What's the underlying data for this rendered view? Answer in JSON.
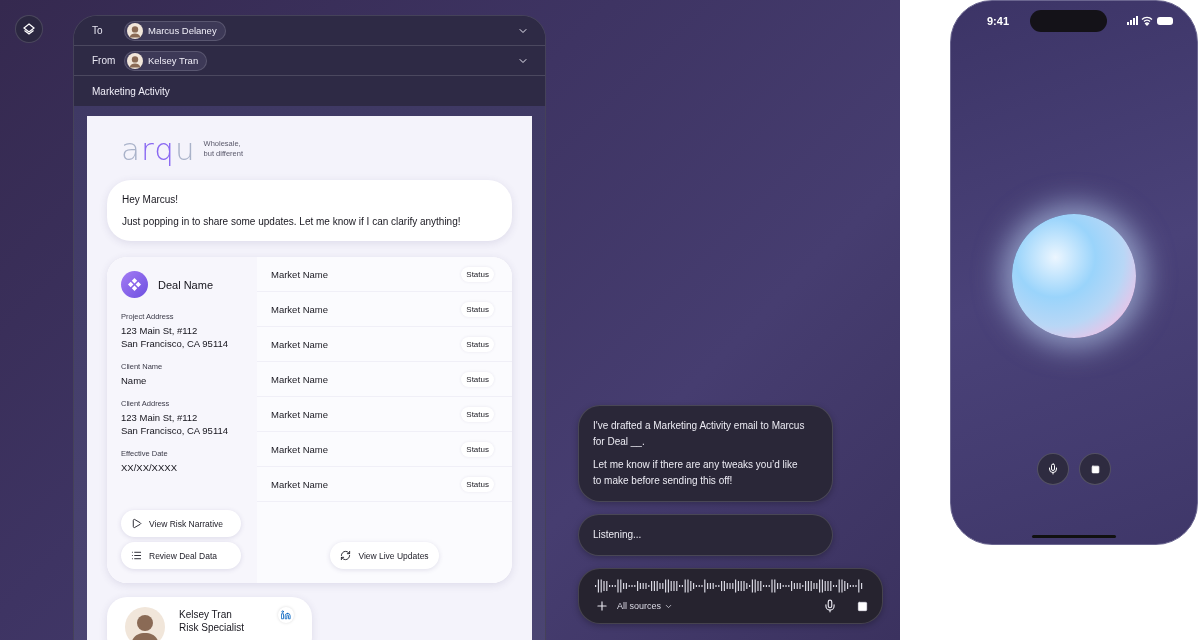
{
  "email": {
    "to": {
      "label": "To",
      "name": "Marcus Delaney"
    },
    "from": {
      "label": "From",
      "name": "Kelsey Tran"
    },
    "subject": "Marketing Activity",
    "brand": {
      "logo": [
        {
          "text": "a",
          "color": "#a9b2c9"
        },
        {
          "text": "rq",
          "color": "#8a68f2"
        },
        {
          "text": "u",
          "color": "#a9b2c9"
        }
      ],
      "tagline": [
        "Wholesale,",
        "but different"
      ]
    },
    "greeting": {
      "title": "Hey Marcus!",
      "body": "Just popping in to share some updates. Let me know if I can clarify anything!"
    },
    "deal": {
      "name": "Deal Name",
      "fields": [
        {
          "label": "Project Address",
          "lines": [
            "123 Main St, #112",
            "San Francisco, CA 95114"
          ]
        },
        {
          "label": "Client Name",
          "lines": [
            "Name"
          ]
        },
        {
          "label": "Client Address",
          "lines": [
            "123 Main St, #112",
            "San Francisco, CA 95114"
          ]
        },
        {
          "label": "Effective Date",
          "lines": [
            "XX/XX/XXXX"
          ]
        }
      ],
      "actions": [
        {
          "kind": "play",
          "label": "View Risk Narrative"
        },
        {
          "kind": "list",
          "label": "Review Deal Data"
        }
      ],
      "markets": [
        {
          "name": "Market Name",
          "status": "Status"
        },
        {
          "name": "Market Name",
          "status": "Status"
        },
        {
          "name": "Market Name",
          "status": "Status"
        },
        {
          "name": "Market Name",
          "status": "Status"
        },
        {
          "name": "Market Name",
          "status": "Status"
        },
        {
          "name": "Market Name",
          "status": "Status"
        },
        {
          "name": "Market Name",
          "status": "Status"
        }
      ],
      "live_button": "View Live Updates"
    },
    "contact": {
      "name": "Kelsey Tran",
      "role": "Risk Specialist"
    }
  },
  "assistant": {
    "message": [
      "I've drafted a Marketing Activity email to Marcus for Deal __.",
      "Let me know if there are any tweaks you’d like to make before sending this off!"
    ],
    "status": "Listening...",
    "composer": {
      "sources": "All sources"
    }
  },
  "phone": {
    "time": "9:41"
  }
}
